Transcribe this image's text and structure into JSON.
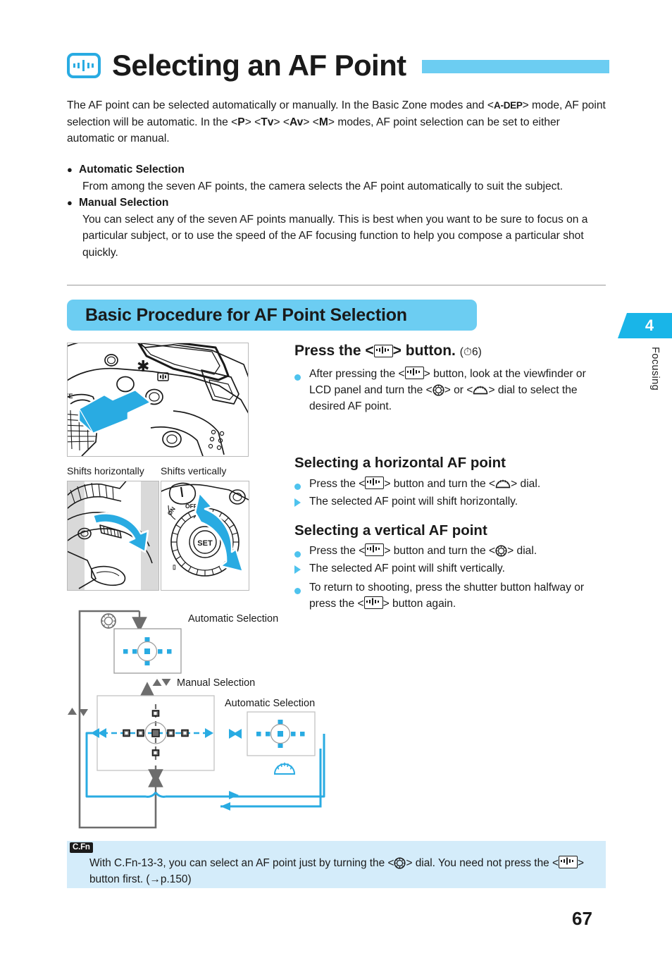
{
  "colors": {
    "accent_cyan": "#29ABE2",
    "heading_bar": "#6CCDF2",
    "tab_blue": "#19B5E8",
    "note_bg": "#D4ECFA",
    "bullet_blue": "#4EC3EE",
    "text": "#1a1a1a"
  },
  "header": {
    "title": "Selecting an AF Point",
    "icon": "af-point-selection-icon"
  },
  "intro": {
    "part1": "The AF point can be selected automatically or manually. In the Basic Zone modes and <",
    "mode_adep": "A-DEP",
    "part2": "> mode, AF point selection will be automatic. In the <",
    "mode_p": "P",
    "part3": "> <",
    "mode_tv": "Tv",
    "part4": "> <",
    "mode_av": "Av",
    "part5": "> <",
    "mode_m": "M",
    "part6": "> modes, AF point selection can be set to either automatic or manual."
  },
  "bullets": [
    {
      "marker": "●",
      "title": "Automatic Selection",
      "body": "From among the seven AF points, the camera selects the AF point automatically to suit the subject."
    },
    {
      "marker": "●",
      "title": "Manual Selection",
      "body": "You can select any of the seven AF points manually. This is best when you want to be sure to focus on a particular subject, or to use the speed of the AF focusing function to help you compose a particular shot quickly."
    }
  ],
  "section": {
    "heading": "Basic Procedure for AF Point Selection"
  },
  "chapter_tab": {
    "number": "4",
    "label": "Focusing"
  },
  "illustrations": {
    "main_alt": "camera-top-af-point-button-press",
    "caption_left": "Shifts horizontally",
    "caption_right": "Shifts vertically",
    "dial_left_alt": "main-dial-turn",
    "dial_right_alt": "quick-control-dial-turn"
  },
  "procedure": {
    "step_title_pre": "Press the <",
    "step_title_icon": "af-point-button-icon",
    "step_title_post": "> button.",
    "step_timer": "(⏱6)",
    "step_bullets": [
      {
        "marker": "dot",
        "text_pre": "After pressing the <",
        "icon1": "af-point-button-icon",
        "text_mid": "> button, look at the viewfinder or LCD panel and turn the <",
        "icon2": "quick-control-dial-icon",
        "text_mid2": "> or <",
        "icon3": "main-dial-icon",
        "text_post": "> dial to select the desired AF point."
      }
    ],
    "horizontal": {
      "heading": "Selecting a horizontal AF point",
      "items": [
        {
          "marker": "dot",
          "pre": "Press the <",
          "icon1": "af-point-button-icon",
          "mid": "> button and turn the <",
          "icon2": "main-dial-icon",
          "post": "> dial."
        },
        {
          "marker": "triangle",
          "text": "The selected AF point will shift horizontally."
        }
      ]
    },
    "vertical": {
      "heading": "Selecting a vertical AF point",
      "items": [
        {
          "marker": "dot",
          "pre": "Press the <",
          "icon1": "af-point-button-icon",
          "mid": "> button and turn the <",
          "icon2": "quick-control-dial-icon",
          "post": "> dial."
        },
        {
          "marker": "triangle",
          "text": "The selected AF point will shift vertically."
        },
        {
          "marker": "dot",
          "pre": "To return to shooting, press the shutter button halfway or press the <",
          "icon1": "af-point-button-icon",
          "post": "> button again."
        }
      ]
    }
  },
  "diagram": {
    "label_auto_top": "Automatic Selection",
    "label_manual": "Manual Selection",
    "label_auto_right": "Automatic Selection",
    "dial_icon_top": "quick-control-dial-icon",
    "dial_icon_bottom": "main-dial-icon",
    "af_point_count": 7
  },
  "note": {
    "badge": "C.Fn",
    "pre": "With C.Fn-13-3, you can select an AF point just by turning the <",
    "icon1": "quick-control-dial-icon",
    "mid": "> dial. You need not press the <",
    "icon2": "af-point-button-icon",
    "post": "> button first. (→p.150)"
  },
  "footer": {
    "page_number": "67"
  }
}
